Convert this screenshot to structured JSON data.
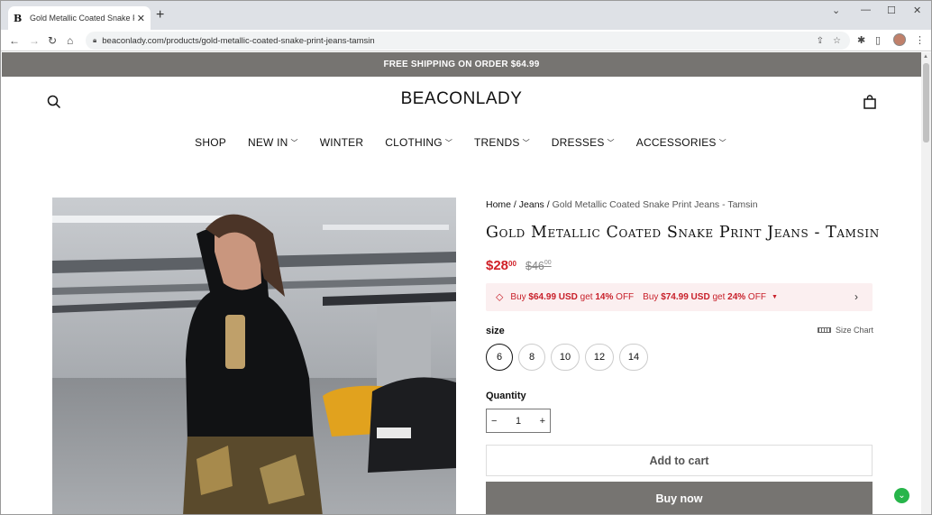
{
  "browser": {
    "tab_title": "Gold Metallic Coated Snake Print",
    "tab_favicon": "B",
    "url": "beaconlady.com/products/gold-metallic-coated-snake-print-jeans-tamsin"
  },
  "banner": {
    "text": "FREE SHIPPING ON ORDER $64.99"
  },
  "header": {
    "logo": "BEACONLADY"
  },
  "menu": [
    {
      "label": "SHOP",
      "dropdown": false
    },
    {
      "label": "NEW IN",
      "dropdown": true
    },
    {
      "label": "WINTER",
      "dropdown": false
    },
    {
      "label": "CLOTHING",
      "dropdown": true
    },
    {
      "label": "TRENDS",
      "dropdown": true
    },
    {
      "label": "DRESSES",
      "dropdown": true
    },
    {
      "label": "ACCESSORIES",
      "dropdown": true
    }
  ],
  "breadcrumb": {
    "home": "Home",
    "sep": " / ",
    "jeans": "Jeans",
    "current": "Gold Metallic Coated Snake Print Jeans - Tamsin"
  },
  "product": {
    "title": "Gold Metallic Coated Snake Print Jeans - Tamsin",
    "price_main": "$28",
    "price_cents": "00",
    "old_price_main": "$46",
    "old_price_cents": "00"
  },
  "promo": {
    "t1a": "Buy ",
    "t1b": "$64.99 USD",
    "t1c": " get ",
    "t1d": "14%",
    "t1e": " OFF",
    "t2a": "Buy ",
    "t2b": "$74.99 USD",
    "t2c": " get ",
    "t2d": "24%",
    "t2e": " OFF"
  },
  "size": {
    "label": "size",
    "chart_label": "Size Chart",
    "options": [
      "6",
      "8",
      "10",
      "12",
      "14"
    ],
    "selected": "6"
  },
  "quantity": {
    "label": "Quantity",
    "value": "1"
  },
  "buttons": {
    "add_to_cart": "Add to cart",
    "buy_now": "Buy now"
  },
  "colors": {
    "banner": "#767471",
    "sale": "#d02027",
    "promo_bg": "#fbeff0"
  }
}
